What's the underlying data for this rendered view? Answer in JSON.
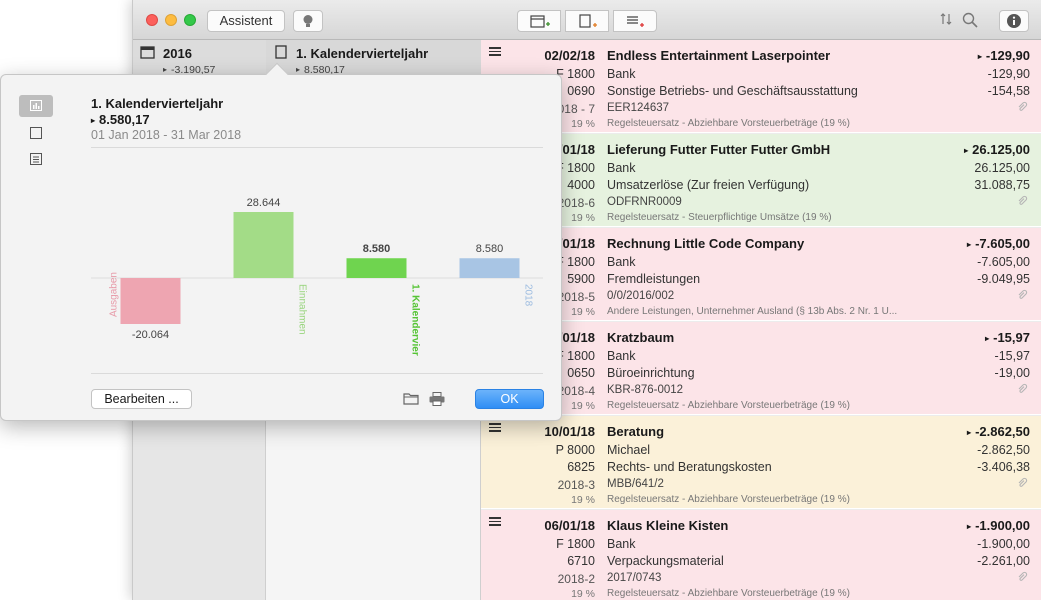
{
  "toolbar": {
    "assistant_label": "Assistent",
    "segment_icons": [
      "calendar-add-icon",
      "document-add-icon",
      "list-add-icon"
    ],
    "right_icons": [
      "sort-icon",
      "search-icon",
      "info-icon"
    ]
  },
  "column1": {
    "title": "2016",
    "amount": "-3.190,57"
  },
  "column2": {
    "title": "1. Kalendervierteljahr",
    "amount": "8.580,17"
  },
  "transactions": [
    {
      "date": "02/02/18",
      "account": "F 1800",
      "account2": "0690",
      "period": "2018 - 7",
      "tax_pct": "19 %",
      "title": "Endless Entertainment Laserpointer",
      "line2": "Bank",
      "line3": "Sonstige Betriebs- und Geschäftsausstattung",
      "ref": "EER124637",
      "note": "Regelsteuersatz - Abziehbare Vorsteuerbeträge (19 %)",
      "amount": "-129,90",
      "amount2": "-129,90",
      "amount3": "-154,58",
      "bg": "#fce4e8"
    },
    {
      "date": "01/01/18",
      "account": "F 1800",
      "account2": "4000",
      "period": "2018-6",
      "tax_pct": "19 %",
      "title": "Lieferung Futter Futter Futter GmbH",
      "line2": "Bank",
      "line3": "Umsatzerlöse (Zur freien Verfügung)",
      "ref": "ODFRNR0009",
      "note": "Regelsteuersatz - Steuerpflichtige Umsätze (19 %)",
      "amount": "26.125,00",
      "amount2": "26.125,00",
      "amount3": "31.088,75",
      "bg": "#e6f2df"
    },
    {
      "date": "01/01/18",
      "account": "F 1800",
      "account2": "5900",
      "period": "2018-5",
      "tax_pct": "19 %",
      "title": "Rechnung Little Code Company",
      "line2": "Bank",
      "line3": "Fremdleistungen",
      "ref": "0/0/2016/002",
      "note": "Andere Leistungen, Unternehmer Ausland (§ 13b Abs. 2 Nr. 1 U...",
      "amount": "-7.605,00",
      "amount2": "-7.605,00",
      "amount3": "-9.049,95",
      "bg": "#fce4e8"
    },
    {
      "date": "01/01/18",
      "account": "F 1800",
      "account2": "0650",
      "period": "2018-4",
      "tax_pct": "19 %",
      "title": "Kratzbaum",
      "line2": "Bank",
      "line3": "Büroeinrichtung",
      "ref": "KBR-876-0012",
      "note": "Regelsteuersatz - Abziehbare Vorsteuerbeträge (19 %)",
      "amount": "-15,97",
      "amount2": "-15,97",
      "amount3": "-19,00",
      "bg": "#fce4e8"
    },
    {
      "date": "10/01/18",
      "account": "P 8000",
      "account2": "6825",
      "period": "2018-3",
      "tax_pct": "19 %",
      "title": "Beratung",
      "line2": "Michael",
      "line3": "Rechts- und Beratungskosten",
      "ref": "MBB/641/2",
      "note": "Regelsteuersatz - Abziehbare Vorsteuerbeträge (19 %)",
      "amount": "-2.862,50",
      "amount2": "-2.862,50",
      "amount3": "-3.406,38",
      "bg": "#fbf1d9"
    },
    {
      "date": "06/01/18",
      "account": "F 1800",
      "account2": "6710",
      "period": "2018-2",
      "tax_pct": "19 %",
      "title": "Klaus Kleine Kisten",
      "line2": "Bank",
      "line3": "Verpackungsmaterial",
      "ref": "2017/0743",
      "note": "Regelsteuersatz - Abziehbare Vorsteuerbeträge (19 %)",
      "amount": "-1.900,00",
      "amount2": "-1.900,00",
      "amount3": "-2.261,00",
      "bg": "#fce4e8"
    }
  ],
  "popover": {
    "title": "1. Kalendervierteljahr",
    "amount": "8.580,17",
    "range": "01 Jan 2018 - 31 Mar 2018",
    "edit_label": "Bearbeiten ...",
    "ok_label": "OK",
    "side_icons": [
      "chart-icon",
      "document-icon",
      "list-icon"
    ]
  },
  "chart_data": {
    "type": "bar",
    "categories": [
      "Ausgaben",
      "Einnahmen",
      "1. Kalendervier",
      "2018"
    ],
    "values": [
      -20064,
      28644,
      8580,
      8580
    ],
    "value_labels": [
      "-20.064",
      "28.644",
      "8.580",
      "8.580"
    ],
    "colors": [
      "#eea5b1",
      "#a3dc87",
      "#6fd44f",
      "#a8c5e4"
    ],
    "label_colors": [
      "#e79aa8",
      "#98d47d",
      "#55c434",
      "#9dbce0"
    ],
    "bold_category": "1. Kalendervier",
    "ylim": [
      -22000,
      30000
    ],
    "grid": false
  }
}
